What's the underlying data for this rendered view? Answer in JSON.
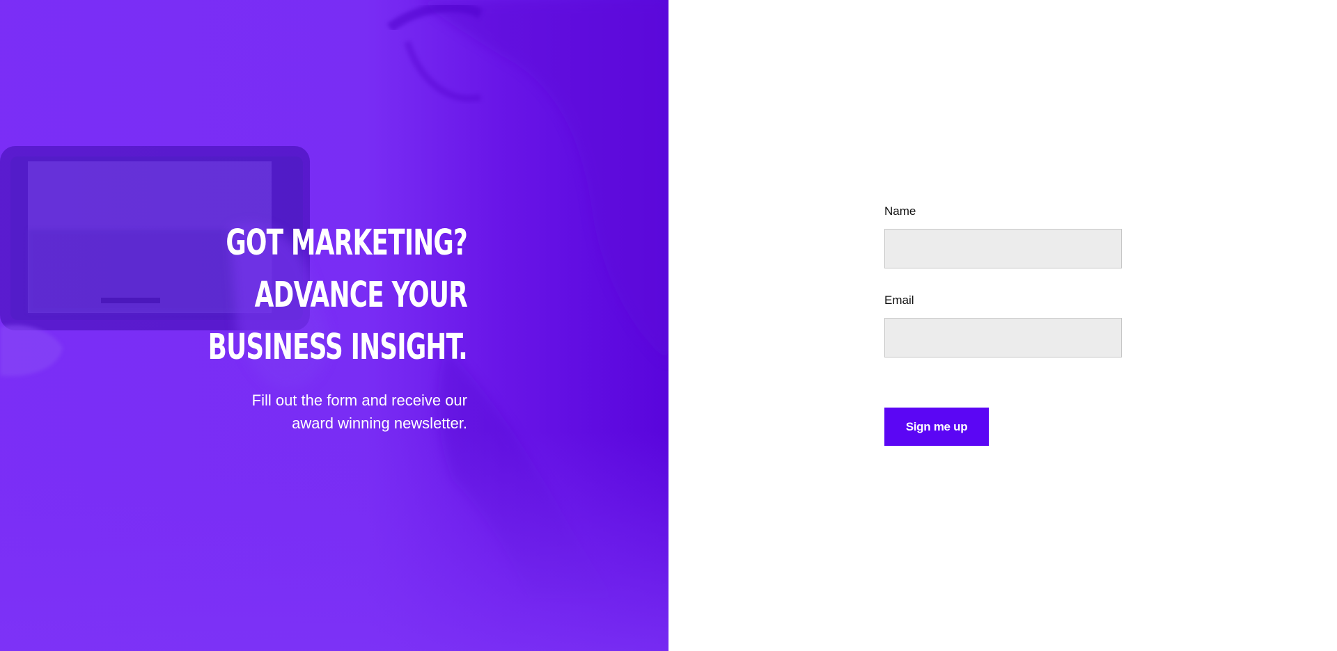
{
  "hero": {
    "title_lines": [
      "GOT MARKETING?",
      "ADVANCE YOUR",
      "BUSINESS INSIGHT."
    ],
    "subtitle_lines": [
      "Fill out the form and receive our",
      "award winning newsletter."
    ],
    "image": "person-holding-phone-photo",
    "overlay_color": "#7a2cf5"
  },
  "form": {
    "name_label": "Name",
    "name_value": "",
    "email_label": "Email",
    "email_value": "",
    "submit_label": "Sign me up",
    "submit_color": "#5b06f4"
  }
}
